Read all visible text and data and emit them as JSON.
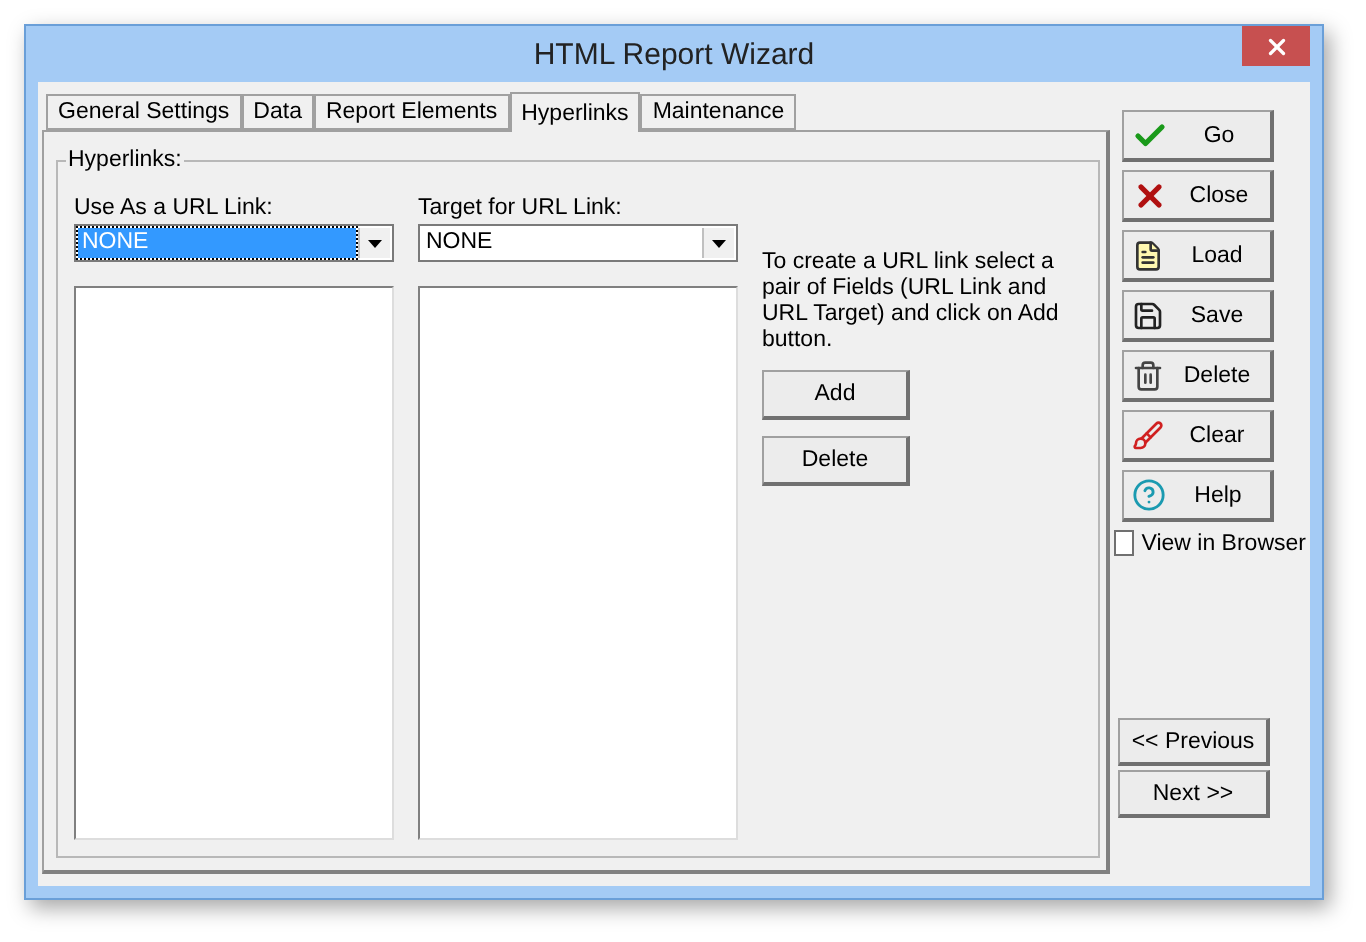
{
  "window": {
    "title": "HTML Report Wizard"
  },
  "tabs": [
    {
      "label": "General Settings",
      "selected": false
    },
    {
      "label": "Data",
      "selected": false
    },
    {
      "label": "Report Elements",
      "selected": false
    },
    {
      "label": "Hyperlinks",
      "selected": true
    },
    {
      "label": "Maintenance",
      "selected": false
    }
  ],
  "group": {
    "title": "Hyperlinks:"
  },
  "dropdowns": [
    {
      "label": "Use As a URL Link:",
      "value": "NONE",
      "focused": true
    },
    {
      "label": "Target for URL Link:",
      "value": "NONE",
      "focused": false
    }
  ],
  "instructions": "To create a URL link select a pair of Fields (URL Link and URL Target) and click on Add button.",
  "link_buttons": [
    "Add",
    "Delete"
  ],
  "side_buttons": [
    {
      "kind": "go",
      "label": "Go"
    },
    {
      "kind": "close",
      "label": "Close"
    },
    {
      "kind": "load",
      "label": "Load"
    },
    {
      "kind": "save",
      "label": "Save"
    },
    {
      "kind": "delete",
      "label": "Delete"
    },
    {
      "kind": "clear",
      "label": "Clear"
    },
    {
      "kind": "help",
      "label": "Help"
    }
  ],
  "view_in_browser": {
    "label": "View in Browser",
    "checked": false
  },
  "nav_buttons": [
    "<< Previous",
    "Next >>"
  ]
}
